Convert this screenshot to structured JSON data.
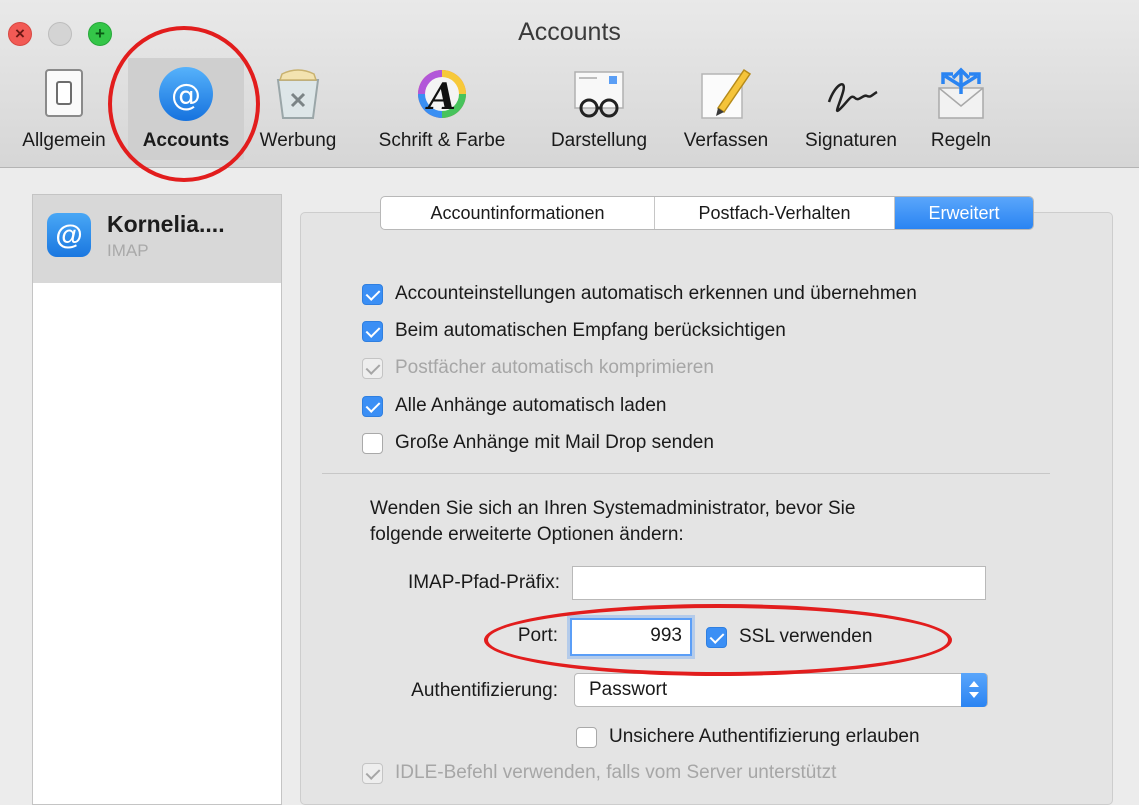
{
  "window": {
    "title": "Accounts"
  },
  "toolbar": {
    "items": [
      {
        "label": "Allgemein",
        "icon": "switch-icon"
      },
      {
        "label": "Accounts",
        "icon": "at-icon"
      },
      {
        "label": "Werbung",
        "icon": "trash-icon"
      },
      {
        "label": "Schrift & Farbe",
        "icon": "font-color-icon"
      },
      {
        "label": "Darstellung",
        "icon": "glasses-icon"
      },
      {
        "label": "Verfassen",
        "icon": "pencil-icon"
      },
      {
        "label": "Signaturen",
        "icon": "signature-icon"
      },
      {
        "label": "Regeln",
        "icon": "rules-envelope-icon"
      }
    ],
    "active": "Accounts"
  },
  "sidebar": {
    "accounts": [
      {
        "name": "Kornelia....",
        "type": "IMAP"
      }
    ]
  },
  "tabs": [
    {
      "label": "Accountinformationen",
      "active": false
    },
    {
      "label": "Postfach-Verhalten",
      "active": false
    },
    {
      "label": "Erweitert",
      "active": true
    }
  ],
  "options": [
    {
      "label": "Accounteinstellungen automatisch erkennen und übernehmen",
      "checked": true,
      "enabled": true
    },
    {
      "label": "Beim automatischen Empfang berücksichtigen",
      "checked": true,
      "enabled": true
    },
    {
      "label": "Postfächer automatisch komprimieren",
      "checked": true,
      "enabled": false
    },
    {
      "label": "Alle Anhänge automatisch laden",
      "checked": true,
      "enabled": true
    },
    {
      "label": "Große Anhänge mit Mail Drop senden",
      "checked": false,
      "enabled": true
    }
  ],
  "advanced": {
    "note_line1": "Wenden Sie sich an Ihren Systemadministrator, bevor Sie",
    "note_line2": "folgende erweiterte Optionen ändern:",
    "imap_prefix_label": "IMAP-Pfad-Präfix:",
    "imap_prefix_value": "",
    "port_label": "Port:",
    "port_value": "993",
    "ssl_label": "SSL verwenden",
    "ssl_checked": true,
    "auth_label": "Authentifizierung:",
    "auth_value": "Passwort",
    "insecure_auth_label": "Unsichere Authentifizierung erlauben",
    "insecure_auth_checked": false,
    "idle_label": "IDLE-Befehl verwenden, falls vom Server unterstützt",
    "idle_checked": true,
    "idle_enabled": false
  },
  "colors": {
    "accent": "#2a84f2",
    "annotation": "#e21d1d"
  }
}
